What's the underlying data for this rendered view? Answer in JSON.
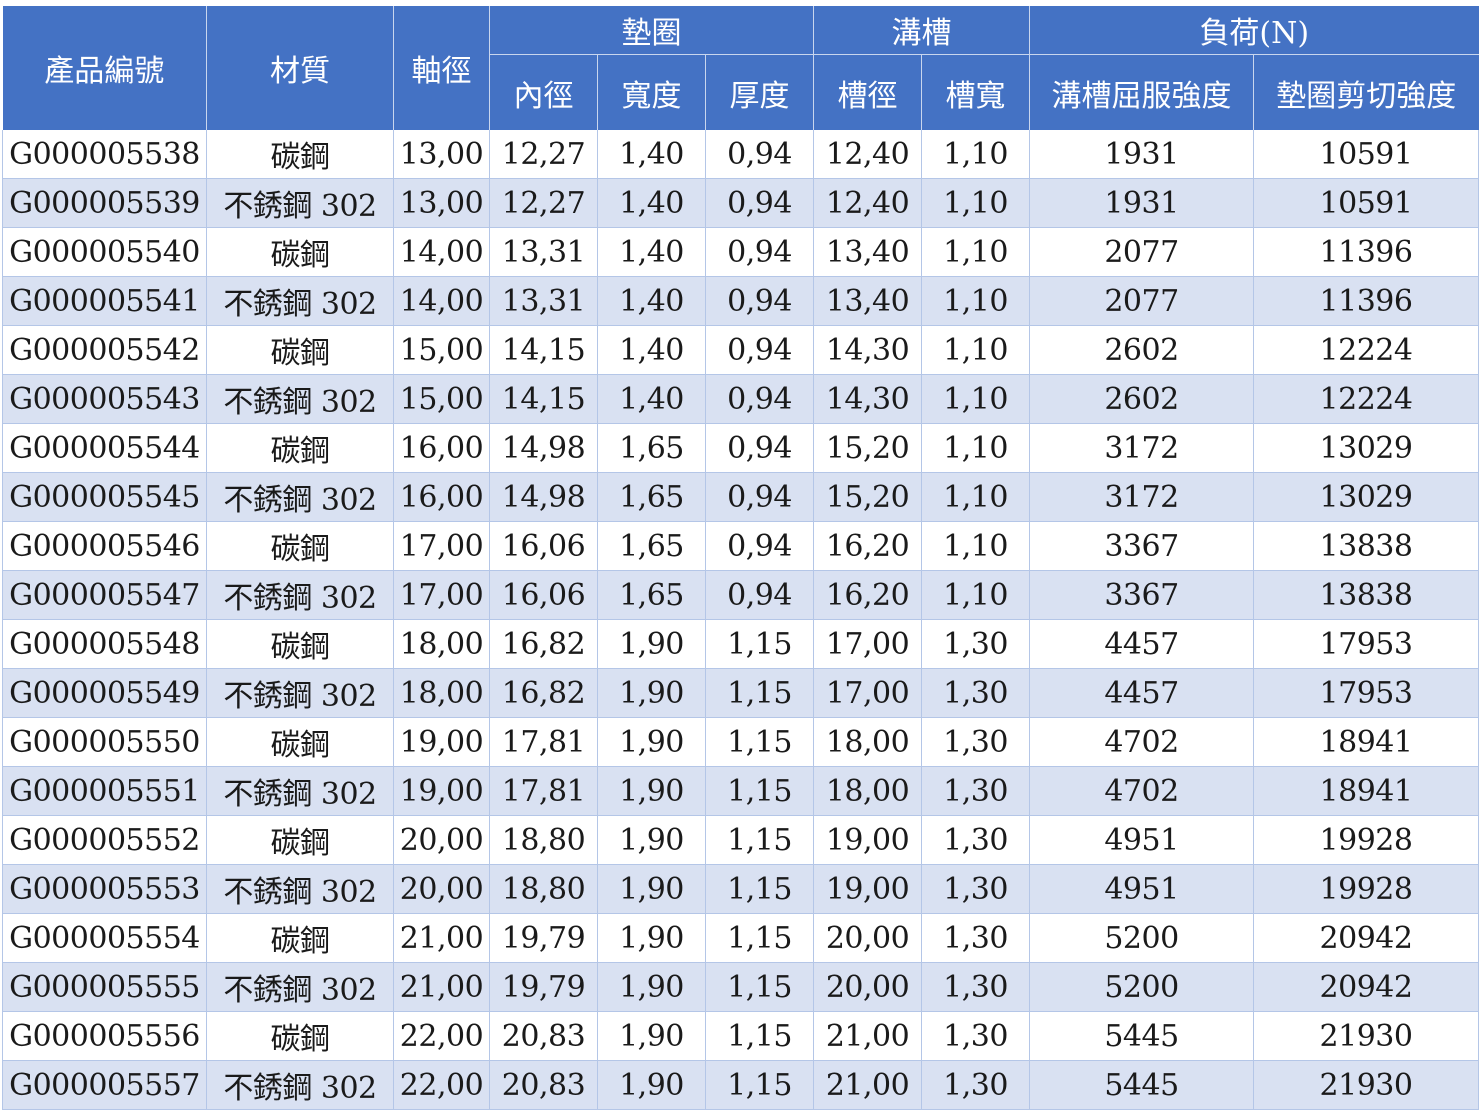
{
  "header": {
    "product_no": "產品編號",
    "material": "材質",
    "shaft_dia": "軸徑",
    "washer": "墊圈",
    "groove": "溝槽",
    "load": "負荷(N)",
    "inner_dia": "內徑",
    "width": "寬度",
    "thickness": "厚度",
    "groove_dia": "槽徑",
    "groove_width": "槽寬",
    "groove_yield": "溝槽屈服強度",
    "washer_shear": "墊圈剪切強度"
  },
  "rows": [
    [
      "G000005538",
      "碳鋼",
      "13,00",
      "12,27",
      "1,40",
      "0,94",
      "12,40",
      "1,10",
      "1931",
      "10591"
    ],
    [
      "G000005539",
      "不銹鋼 302",
      "13,00",
      "12,27",
      "1,40",
      "0,94",
      "12,40",
      "1,10",
      "1931",
      "10591"
    ],
    [
      "G000005540",
      "碳鋼",
      "14,00",
      "13,31",
      "1,40",
      "0,94",
      "13,40",
      "1,10",
      "2077",
      "11396"
    ],
    [
      "G000005541",
      "不銹鋼 302",
      "14,00",
      "13,31",
      "1,40",
      "0,94",
      "13,40",
      "1,10",
      "2077",
      "11396"
    ],
    [
      "G000005542",
      "碳鋼",
      "15,00",
      "14,15",
      "1,40",
      "0,94",
      "14,30",
      "1,10",
      "2602",
      "12224"
    ],
    [
      "G000005543",
      "不銹鋼 302",
      "15,00",
      "14,15",
      "1,40",
      "0,94",
      "14,30",
      "1,10",
      "2602",
      "12224"
    ],
    [
      "G000005544",
      "碳鋼",
      "16,00",
      "14,98",
      "1,65",
      "0,94",
      "15,20",
      "1,10",
      "3172",
      "13029"
    ],
    [
      "G000005545",
      "不銹鋼 302",
      "16,00",
      "14,98",
      "1,65",
      "0,94",
      "15,20",
      "1,10",
      "3172",
      "13029"
    ],
    [
      "G000005546",
      "碳鋼",
      "17,00",
      "16,06",
      "1,65",
      "0,94",
      "16,20",
      "1,10",
      "3367",
      "13838"
    ],
    [
      "G000005547",
      "不銹鋼 302",
      "17,00",
      "16,06",
      "1,65",
      "0,94",
      "16,20",
      "1,10",
      "3367",
      "13838"
    ],
    [
      "G000005548",
      "碳鋼",
      "18,00",
      "16,82",
      "1,90",
      "1,15",
      "17,00",
      "1,30",
      "4457",
      "17953"
    ],
    [
      "G000005549",
      "不銹鋼 302",
      "18,00",
      "16,82",
      "1,90",
      "1,15",
      "17,00",
      "1,30",
      "4457",
      "17953"
    ],
    [
      "G000005550",
      "碳鋼",
      "19,00",
      "17,81",
      "1,90",
      "1,15",
      "18,00",
      "1,30",
      "4702",
      "18941"
    ],
    [
      "G000005551",
      "不銹鋼 302",
      "19,00",
      "17,81",
      "1,90",
      "1,15",
      "18,00",
      "1,30",
      "4702",
      "18941"
    ],
    [
      "G000005552",
      "碳鋼",
      "20,00",
      "18,80",
      "1,90",
      "1,15",
      "19,00",
      "1,30",
      "4951",
      "19928"
    ],
    [
      "G000005553",
      "不銹鋼 302",
      "20,00",
      "18,80",
      "1,90",
      "1,15",
      "19,00",
      "1,30",
      "4951",
      "19928"
    ],
    [
      "G000005554",
      "碳鋼",
      "21,00",
      "19,79",
      "1,90",
      "1,15",
      "20,00",
      "1,30",
      "5200",
      "20942"
    ],
    [
      "G000005555",
      "不銹鋼 302",
      "21,00",
      "19,79",
      "1,90",
      "1,15",
      "20,00",
      "1,30",
      "5200",
      "20942"
    ],
    [
      "G000005556",
      "碳鋼",
      "22,00",
      "20,83",
      "1,90",
      "1,15",
      "21,00",
      "1,30",
      "5445",
      "21930"
    ],
    [
      "G000005557",
      "不銹鋼 302",
      "22,00",
      "20,83",
      "1,90",
      "1,15",
      "21,00",
      "1,30",
      "5445",
      "21930"
    ]
  ],
  "colors": {
    "header_bg": "#4472c4",
    "header_text": "#ffffff",
    "row_stripe": "#d9e1f2",
    "grid_line": "#b4c6e7"
  }
}
